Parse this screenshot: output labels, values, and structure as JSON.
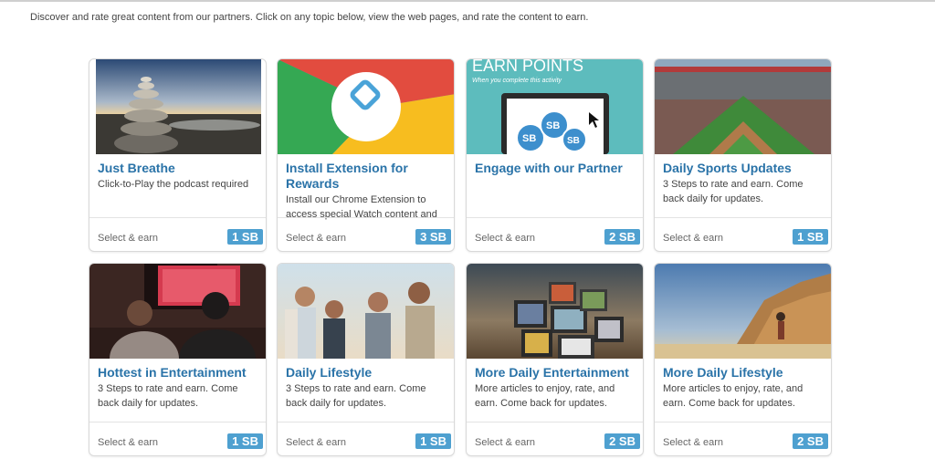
{
  "intro_text": "Discover and rate great content from our partners. Click on any topic below, view the web pages, and rate the content to earn.",
  "footer_label": "Select & earn",
  "badge_color": "#4ea0d0",
  "title_color": "#2a73a8",
  "cards": [
    {
      "title": "Just Breathe",
      "description": "Click-to-Play the podcast required",
      "reward": "1 SB",
      "image": "stacked-stones-beach-image"
    },
    {
      "title": "Install Extension for Rewards",
      "description": "Install our Chrome Extension to access special Watch content and",
      "reward": "3 SB",
      "image": "swagbucks-chrome-logo-image"
    },
    {
      "title": "Engage with our Partner",
      "description": "",
      "reward": "2 SB",
      "image": "earn-points-laptop-image",
      "image_text": {
        "headline": "EARN POINTS",
        "subline": "When you complete this activity",
        "coin": "SB"
      }
    },
    {
      "title": "Daily Sports Updates",
      "description": "3 Steps to rate and earn. Come back daily for updates.",
      "reward": "1 SB",
      "image": "baseball-stadium-image"
    },
    {
      "title": "Hottest in Entertainment",
      "description": "3 Steps to rate and earn. Come back daily for updates.",
      "reward": "1 SB",
      "image": "couple-watching-tv-image"
    },
    {
      "title": "Daily Lifestyle",
      "description": "3 Steps to rate and earn. Come back daily for updates.",
      "reward": "1 SB",
      "image": "friends-laughing-outdoors-image"
    },
    {
      "title": "More Daily Entertainment",
      "description": "More articles to enjoy, rate, and earn. Come back for updates.",
      "reward": "2 SB",
      "image": "retro-tv-stack-image"
    },
    {
      "title": "More Daily Lifestyle",
      "description": "More articles to enjoy, rate, and earn. Come back for updates.",
      "reward": "2 SB",
      "image": "woman-on-beach-cliff-image"
    }
  ]
}
